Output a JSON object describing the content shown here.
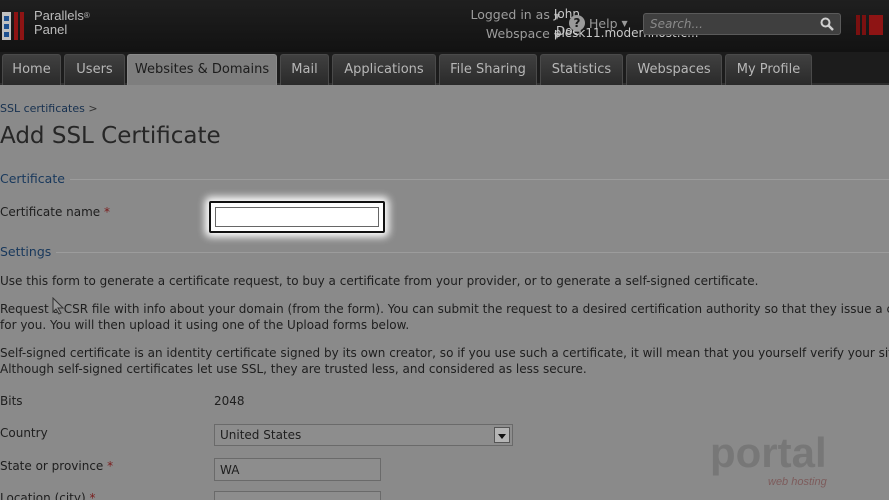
{
  "header": {
    "logo_line1": "Parallels",
    "logo_line2": "Panel",
    "logged_in_label": "Logged in as",
    "user_name": "John Doe",
    "webspace_label": "Webspace",
    "webspace_value": "plesk11.modernhost.c...",
    "help_label": "Help",
    "search_placeholder": "Search..."
  },
  "nav": {
    "tabs": [
      {
        "label": "Home"
      },
      {
        "label": "Users"
      },
      {
        "label": "Websites & Domains"
      },
      {
        "label": "Mail"
      },
      {
        "label": "Applications"
      },
      {
        "label": "File Sharing"
      },
      {
        "label": "Statistics"
      },
      {
        "label": "Webspaces"
      },
      {
        "label": "My Profile"
      }
    ]
  },
  "breadcrumb": {
    "link": "SSL certificates",
    "separator": ">"
  },
  "page": {
    "title": "Add SSL Certificate"
  },
  "certificate_section": {
    "title": "Certificate",
    "name_label": "Certificate name",
    "required_mark": "*"
  },
  "settings_section": {
    "title": "Settings",
    "para1": "Use this form to generate a certificate request, to buy a certificate from your provider, or to generate a self-signed certificate.",
    "para2_line1": "Request a CSR file with info about your domain (from the form). You can submit the request to a desired certification authority so that they issue a c",
    "para2_line2": "for you. You will then upload it using one of the Upload forms below.",
    "para3_line1": "Self-signed certificate is an identity certificate signed by its own creator, so if you use such a certificate, it will mean that you yourself verify your site",
    "para3_line2": "Although self-signed certificates let use SSL, they are trusted less, and considered as less secure.",
    "bits_label": "Bits",
    "bits_value": "2048",
    "country_label": "Country",
    "country_value": "United States",
    "state_label": "State or province",
    "state_value": "WA",
    "location_label": "Location (city)"
  },
  "watermark": {
    "line1": "portal",
    "line2": "web hosting"
  },
  "colors": {
    "active_tab": "#7e7e7e",
    "header_bg": "#1a1a1a",
    "section_title": "#18385c"
  }
}
